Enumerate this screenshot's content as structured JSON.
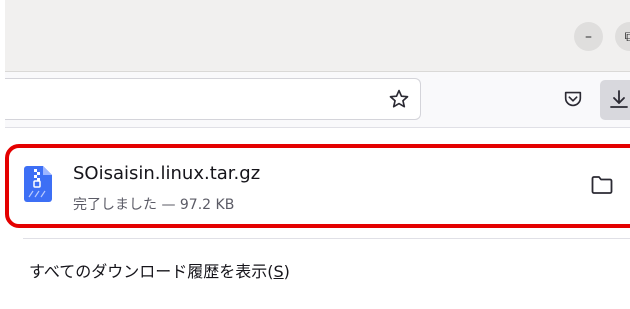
{
  "window": {
    "minimize_glyph": "–",
    "restore_glyph": "⧉"
  },
  "toolbar": {
    "bookmark_icon": "star-icon",
    "pocket_icon": "pocket-icon",
    "downloads_icon": "download-arrow-icon"
  },
  "downloads": {
    "items": [
      {
        "file_name": "SOisaisin.linux.tar.gz",
        "status": "完了しました — 97.2 KB",
        "icon": "archive-file-icon",
        "action_icon": "folder-icon"
      }
    ],
    "show_all_label": "すべてのダウンロード履歴を表示(",
    "show_all_accesskey": "S",
    "show_all_suffix": ")"
  },
  "colors": {
    "highlight_border": "#e40000",
    "titlebar_bg": "#f1f0ef",
    "toolbar_bg": "#f9f9fb",
    "download_button_active": "#d8d8dd",
    "archive_icon": "#3d6ff5"
  }
}
